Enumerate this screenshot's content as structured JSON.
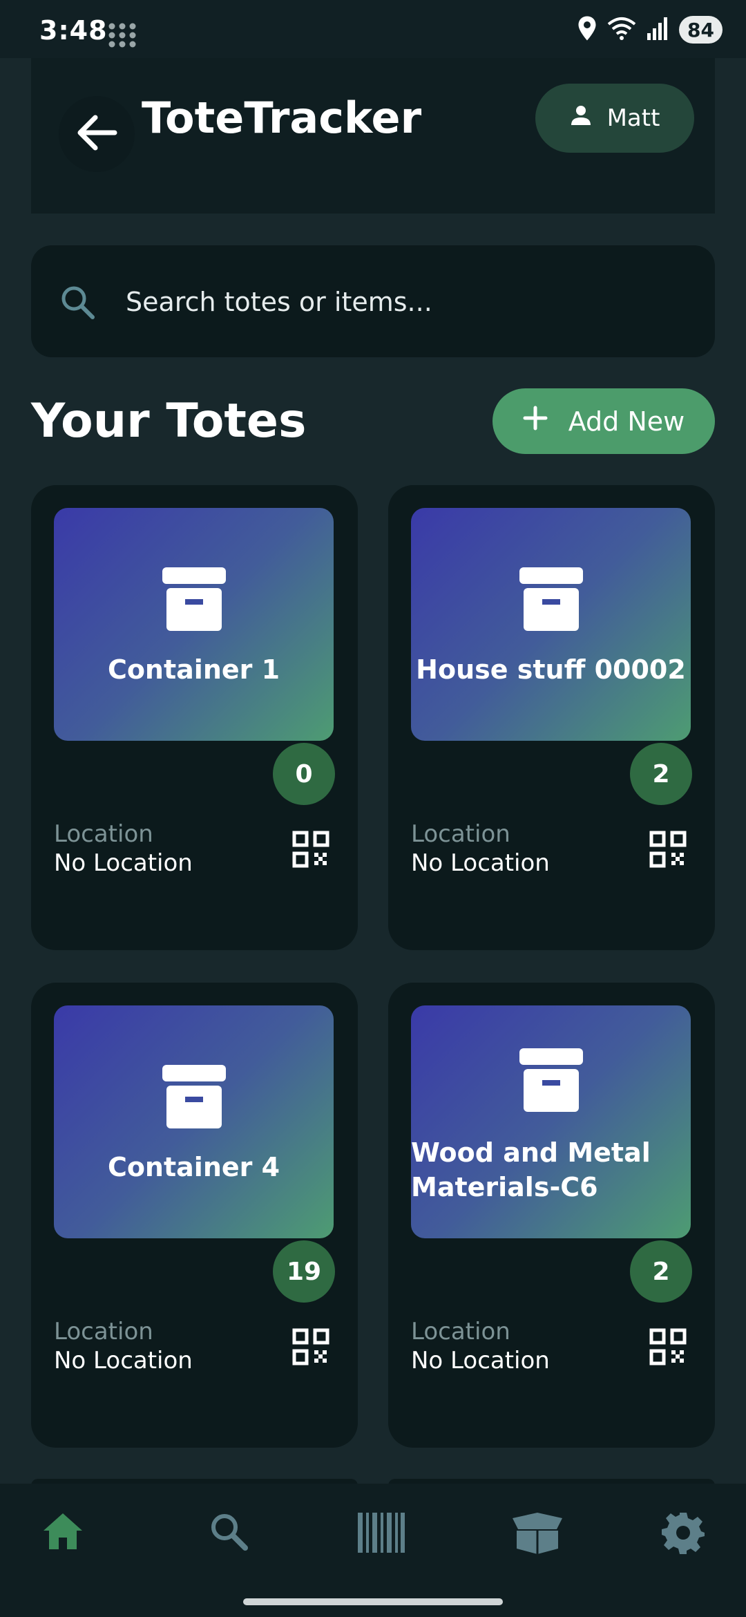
{
  "status": {
    "time": "3:48",
    "battery": "84"
  },
  "header": {
    "title": "ToteTracker",
    "user_name": "Matt"
  },
  "search": {
    "placeholder": "Search totes or items..."
  },
  "section": {
    "title": "Your Totes",
    "add_label": "Add New"
  },
  "totes": [
    {
      "name": "Container 1",
      "count": "0",
      "location_label": "Location",
      "location": "No Location"
    },
    {
      "name": "House stuff 00002",
      "count": "2",
      "location_label": "Location",
      "location": "No Location"
    },
    {
      "name": "Container 4",
      "count": "19",
      "location_label": "Location",
      "location": "No Location"
    },
    {
      "name": "Wood and Metal Materials-C6",
      "count": "2",
      "location_label": "Location",
      "location": "No Location"
    }
  ],
  "nav": [
    {
      "icon": "home-icon",
      "active": true
    },
    {
      "icon": "search-icon",
      "active": false
    },
    {
      "icon": "barcode-icon",
      "active": false
    },
    {
      "icon": "open-box-icon",
      "active": false
    },
    {
      "icon": "gear-icon",
      "active": false
    }
  ],
  "colors": {
    "accent": "#4c9c6b",
    "badge": "#2f6a42",
    "nav_active": "#3d8c5a",
    "nav_inactive": "#5d7f89"
  }
}
